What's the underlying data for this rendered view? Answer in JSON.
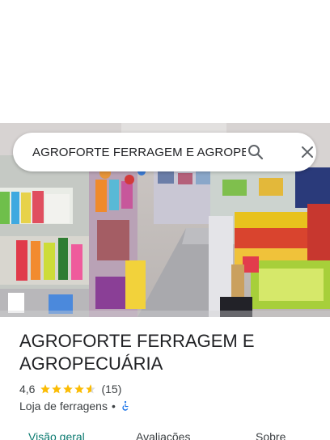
{
  "search": {
    "query": "AGROFORTE FERRAGEM E AGROPECUÁRIA"
  },
  "place": {
    "name": "AGROFORTE FERRAGEM E AGROPECUÁRIA",
    "rating": "4,6",
    "rating_value": 4.6,
    "reviews": "(15)",
    "category": "Loja de ferragens",
    "separator": "•"
  },
  "tabs": [
    {
      "label": "Visão geral",
      "active": true
    },
    {
      "label": "Avaliações",
      "active": false
    },
    {
      "label": "Sobre",
      "active": false
    }
  ],
  "colors": {
    "star": "#fbbc04",
    "accent": "#0b7a70",
    "accessible": "#1a73e8"
  },
  "icons": {
    "search": "search-icon",
    "close": "close-icon",
    "accessible": "wheelchair-icon"
  }
}
